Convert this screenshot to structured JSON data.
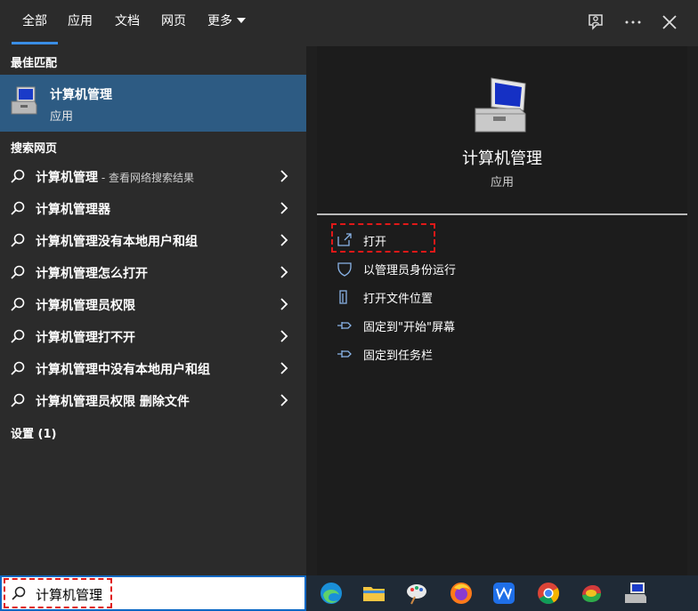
{
  "tabs": [
    {
      "label": "全部",
      "active": true
    },
    {
      "label": "应用"
    },
    {
      "label": "文档"
    },
    {
      "label": "网页"
    },
    {
      "label": "更多"
    }
  ],
  "top_icons": [
    "feedback-icon",
    "more-icon",
    "close-icon"
  ],
  "left": {
    "best_match_header": "最佳匹配",
    "best_match": {
      "title": "计算机管理",
      "subtitle": "应用",
      "icon": "computer-management-icon"
    },
    "web_header": "搜索网页",
    "web_results": [
      {
        "label": "计算机管理",
        "suffix": " - 查看网络搜索结果"
      },
      {
        "label": "计算机管理器",
        "suffix": ""
      },
      {
        "label": "计算机管理没有本地用户和组",
        "suffix": ""
      },
      {
        "label": "计算机管理怎么打开",
        "suffix": ""
      },
      {
        "label": "计算机管理员权限",
        "suffix": ""
      },
      {
        "label": "计算机管理打不开",
        "suffix": ""
      },
      {
        "label": "计算机管理中没有本地用户和组",
        "suffix": ""
      },
      {
        "label": "计算机管理员权限 删除文件",
        "suffix": ""
      }
    ],
    "settings_header": "设置 (1)"
  },
  "right": {
    "app_title": "计算机管理",
    "app_subtitle": "应用",
    "actions": [
      {
        "label": "打开",
        "icon": "open-icon"
      },
      {
        "label": "以管理员身份运行",
        "icon": "shield-icon"
      },
      {
        "label": "打开文件位置",
        "icon": "folder-location-icon"
      },
      {
        "label": "固定到\"开始\"屏幕",
        "icon": "pin-icon"
      },
      {
        "label": "固定到任务栏",
        "icon": "pin-icon"
      }
    ]
  },
  "search": {
    "value": "计算机管理",
    "icon": "search-icon"
  },
  "taskbar": [
    "edge-icon",
    "file-explorer-icon",
    "paint-icon",
    "firefox-icon",
    "wps-icon",
    "chrome-icon",
    "app-icon",
    "computer-management-icon"
  ],
  "colors": {
    "accent": "#3a8ee6",
    "highlight": "#2d5b83",
    "annotation": "#e01818"
  }
}
